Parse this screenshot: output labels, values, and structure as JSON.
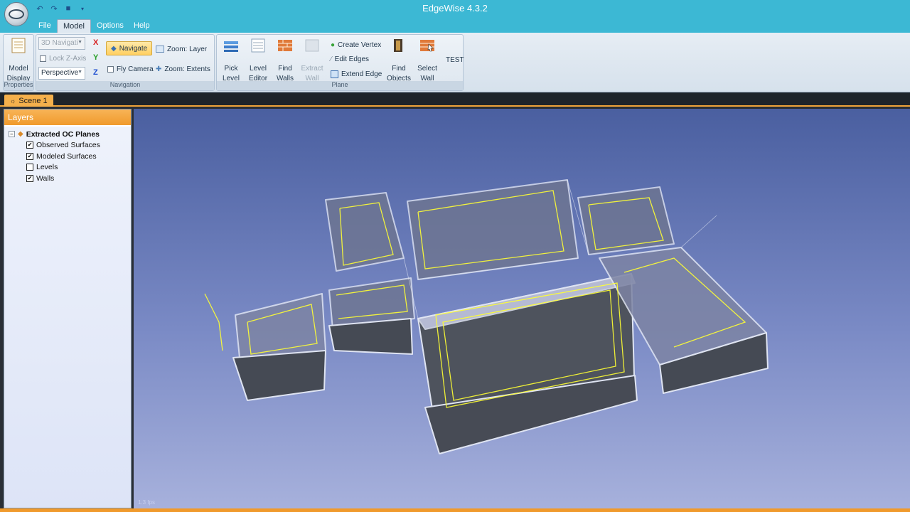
{
  "window": {
    "title": "EdgeWise 4.3.2"
  },
  "menu": {
    "file": "File",
    "model": "Model",
    "options": "Options",
    "help": "Help"
  },
  "ribbon": {
    "properties": {
      "label": "Properties",
      "model_display": "Model\nDisplay"
    },
    "navigation": {
      "label": "Navigation",
      "mode_value": "3D Navigati",
      "lock_z": "Lock Z-Axis",
      "projection_value": "Perspective",
      "axis_x": "X",
      "axis_y": "Y",
      "axis_z": "Z",
      "navigate": "Navigate",
      "fly_camera": "Fly Camera",
      "zoom_layer": "Zoom: Layer",
      "zoom_extents": "Zoom: Extents"
    },
    "plane": {
      "label": "Plane",
      "pick_level": "Pick\nLevel",
      "level_editor": "Level\nEditor",
      "find_walls": "Find\nWalls",
      "extract_wall": "Extract\nWall",
      "create_vertex": "Create Vertex",
      "edit_edges": "Edit Edges",
      "extend_edge": "Extend Edge",
      "find_objects": "Find\nObjects",
      "select_wall": "Select\nWall"
    },
    "test": "TEST"
  },
  "doc_tab": "Scene 1",
  "layers": {
    "header": "Layers",
    "root": "Extracted OC Planes",
    "items": [
      {
        "label": "Observed Surfaces",
        "checked": true
      },
      {
        "label": "Modeled Surfaces",
        "checked": true
      },
      {
        "label": "Levels",
        "checked": false
      },
      {
        "label": "Walls",
        "checked": true
      }
    ]
  },
  "viewport": {
    "fps": "1.3 fps"
  },
  "colors": {
    "accent": "#f09a2c",
    "titlebar": "#3cb8d4",
    "wall_outline": "#ffff33"
  }
}
